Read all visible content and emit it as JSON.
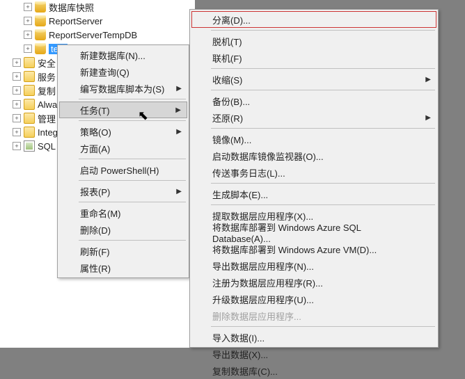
{
  "tree": {
    "items": [
      {
        "label": "数据库快照",
        "icon": "db"
      },
      {
        "label": "ReportServer",
        "icon": "db"
      },
      {
        "label": "ReportServerTempDB",
        "icon": "db"
      },
      {
        "label": "test",
        "icon": "db",
        "selected": true
      },
      {
        "label": "安全",
        "icon": "folder"
      },
      {
        "label": "服务",
        "icon": "folder"
      },
      {
        "label": "复制",
        "icon": "folder"
      },
      {
        "label": "Alwa",
        "icon": "folder"
      },
      {
        "label": "管理",
        "icon": "folder"
      },
      {
        "label": "Integ",
        "icon": "folder"
      },
      {
        "label": "SQL",
        "icon": "sql"
      }
    ]
  },
  "menu1": {
    "items": [
      {
        "label": "新建数据库(N)..."
      },
      {
        "label": "新建查询(Q)"
      },
      {
        "label": "编写数据库脚本为(S)",
        "submenu": true
      },
      {
        "sep": true
      },
      {
        "label": "任务(T)",
        "submenu": true,
        "hovered": true
      },
      {
        "sep": true
      },
      {
        "label": "策略(O)",
        "submenu": true
      },
      {
        "label": "方面(A)"
      },
      {
        "sep": true
      },
      {
        "label": "启动 PowerShell(H)"
      },
      {
        "sep": true
      },
      {
        "label": "报表(P)",
        "submenu": true
      },
      {
        "sep": true
      },
      {
        "label": "重命名(M)"
      },
      {
        "label": "删除(D)"
      },
      {
        "sep": true
      },
      {
        "label": "刷新(F)"
      },
      {
        "label": "属性(R)"
      }
    ]
  },
  "menu2": {
    "items": [
      {
        "label": "分离(D)...",
        "highlight": true
      },
      {
        "sep": true
      },
      {
        "label": "脱机(T)"
      },
      {
        "label": "联机(F)"
      },
      {
        "sep": true
      },
      {
        "label": "收缩(S)",
        "submenu": true
      },
      {
        "sep": true
      },
      {
        "label": "备份(B)..."
      },
      {
        "label": "还原(R)",
        "submenu": true
      },
      {
        "sep": true
      },
      {
        "label": "镜像(M)..."
      },
      {
        "label": "启动数据库镜像监视器(O)..."
      },
      {
        "label": "传送事务日志(L)..."
      },
      {
        "sep": true
      },
      {
        "label": "生成脚本(E)..."
      },
      {
        "sep": true
      },
      {
        "label": "提取数据层应用程序(X)..."
      },
      {
        "label": "将数据库部署到 Windows Azure SQL Database(A)..."
      },
      {
        "label": "将数据库部署到 Windows Azure VM(D)..."
      },
      {
        "label": "导出数据层应用程序(N)..."
      },
      {
        "label": "注册为数据层应用程序(R)..."
      },
      {
        "label": "升级数据层应用程序(U)..."
      },
      {
        "label": "删除数据层应用程序...",
        "disabled": true
      },
      {
        "sep": true
      },
      {
        "label": "导入数据(I)..."
      },
      {
        "label": "导出数据(X)..."
      },
      {
        "label": "复制数据库(C)..."
      }
    ]
  }
}
